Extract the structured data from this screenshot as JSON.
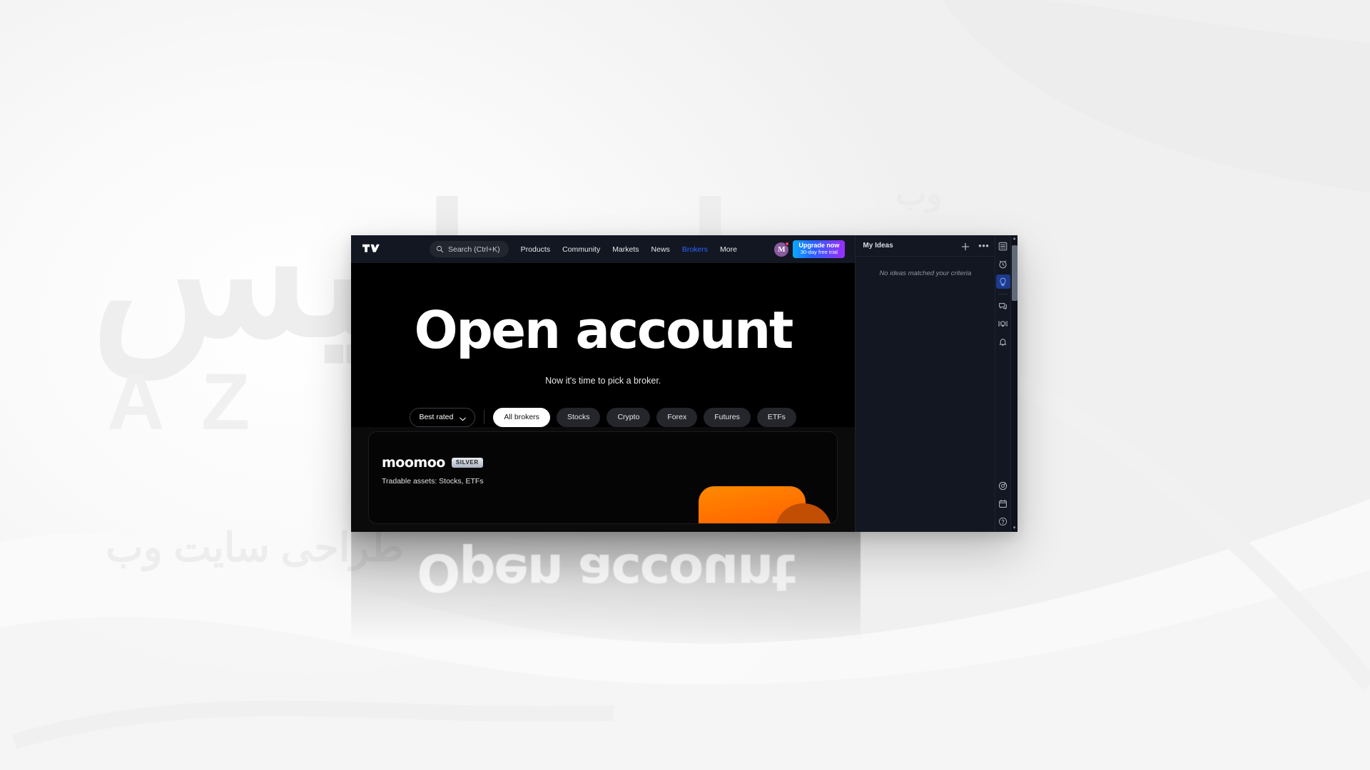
{
  "window": {
    "app": "TradingView",
    "logo_icon": "tradingview-logo"
  },
  "header": {
    "search": {
      "placeholder": "Search (Ctrl+K)",
      "icon": "search-icon"
    },
    "nav": [
      {
        "label": "Products",
        "active": false
      },
      {
        "label": "Community",
        "active": false
      },
      {
        "label": "Markets",
        "active": false
      },
      {
        "label": "News",
        "active": false
      },
      {
        "label": "Brokers",
        "active": true
      },
      {
        "label": "More",
        "active": false
      }
    ],
    "avatar": {
      "initial": "M",
      "notification_dot": true
    },
    "upgrade": {
      "line1": "Upgrade now",
      "line2": "30-day free trial"
    },
    "colors": {
      "active_nav": "#2962ff",
      "header_bg": "#131722",
      "upgrade_gradient_start": "#0aa9ff",
      "upgrade_gradient_end": "#9b2dff",
      "avatar_bg": "#8a5a9e",
      "notification_dot": "#ff3b6b"
    }
  },
  "hero": {
    "title": "Open account",
    "subtitle": "Now it's time to pick a broker."
  },
  "filters": {
    "sort": {
      "label": "Best rated",
      "icon": "chevron-down-icon"
    },
    "pills": [
      {
        "label": "All brokers",
        "active": true
      },
      {
        "label": "Stocks",
        "active": false
      },
      {
        "label": "Crypto",
        "active": false
      },
      {
        "label": "Forex",
        "active": false
      },
      {
        "label": "Futures",
        "active": false
      },
      {
        "label": "ETFs",
        "active": false
      }
    ],
    "active_pill_bg": "#ffffff"
  },
  "broker_card": {
    "name": "moomoo",
    "tier_badge": "SILVER",
    "assets_label": "Tradable assets: Stocks, ETFs",
    "brand_color": "#ff6a00"
  },
  "right_panel": {
    "title": "My Ideas",
    "add_icon": "plus-icon",
    "more_icon": "more-horizontal-icon",
    "empty_message": "No ideas matched your criteria"
  },
  "icon_rail": {
    "top": [
      {
        "name": "watchlist-icon",
        "label": "Watchlist",
        "active": false
      },
      {
        "name": "alert-clock-icon",
        "label": "Alerts",
        "active": false
      },
      {
        "name": "lightbulb-icon",
        "label": "Ideas",
        "active": true
      }
    ],
    "middle": [
      {
        "name": "chat-bubble-icon",
        "label": "Chat",
        "active": false
      },
      {
        "name": "broadcast-idea-icon",
        "label": "Streams",
        "active": false
      },
      {
        "name": "bell-icon",
        "label": "Notifications",
        "active": false
      }
    ],
    "bottom": [
      {
        "name": "compass-icon",
        "label": "Explore",
        "active": false
      },
      {
        "name": "calendar-icon",
        "label": "Calendar",
        "active": false
      },
      {
        "name": "help-icon",
        "label": "Help",
        "active": false
      }
    ]
  },
  "scrollbar": {
    "up_arrow": "▲",
    "down_arrow": "▼"
  },
  "background": {
    "watermark_main": "ایساتیس",
    "watermark_sub": "A  Z",
    "watermark_small": "طراحی سایت وب",
    "watermark_right": "وب"
  }
}
